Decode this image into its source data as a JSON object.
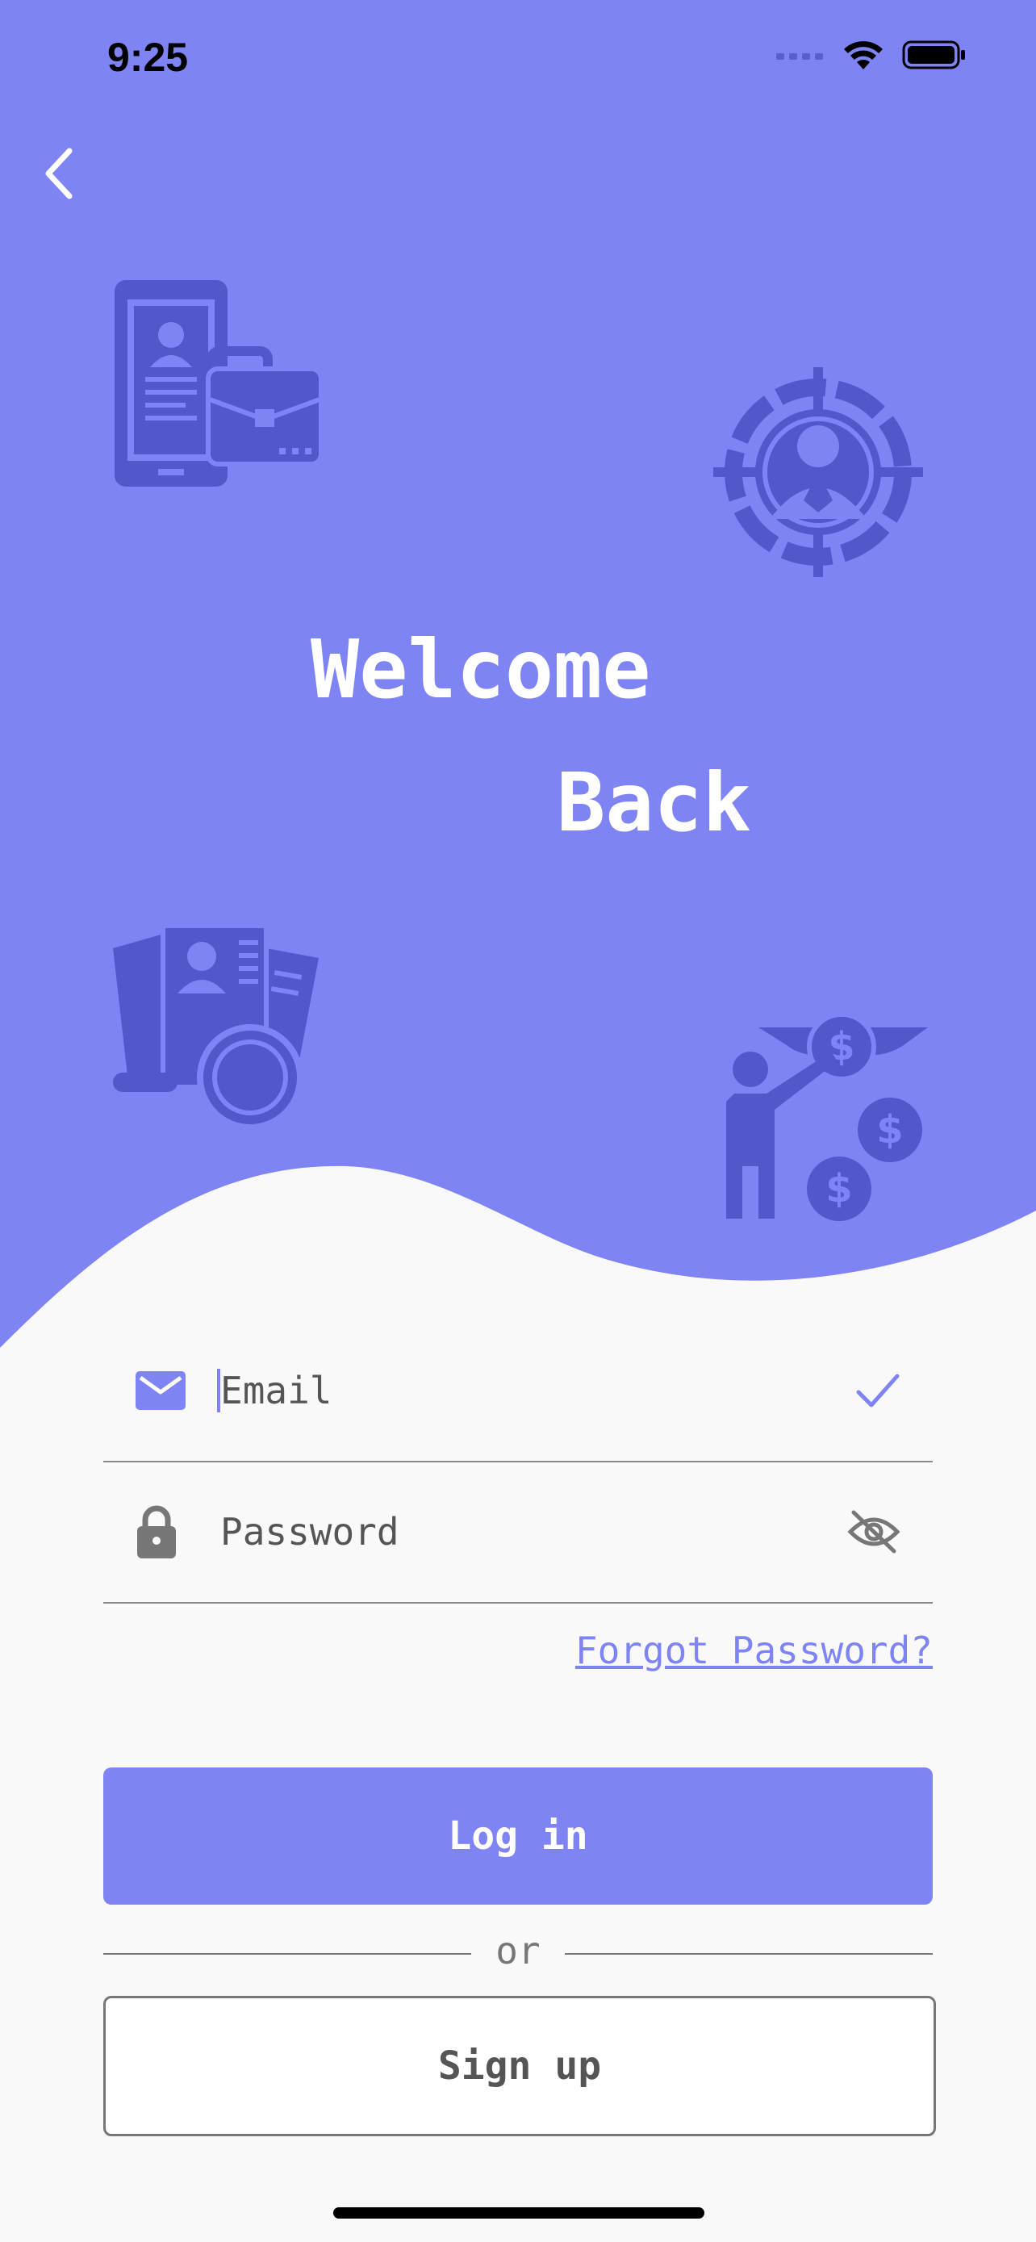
{
  "status_bar": {
    "time": "9:25"
  },
  "header": {
    "title_line1": "Welcome",
    "title_line2": "Back"
  },
  "form": {
    "email": {
      "placeholder": "Email"
    },
    "password": {
      "placeholder": "Password"
    },
    "forgot_label": "Forgot Password?"
  },
  "actions": {
    "login_label": "Log in",
    "or_label": "or",
    "signup_label": "Sign up"
  },
  "colors": {
    "accent": "#7f84f4",
    "accent_dark": "#5158c9",
    "background": "#f9f9f9"
  },
  "icons": [
    "wifi-icon",
    "battery-icon",
    "back-chevron-icon",
    "mail-icon",
    "lock-icon",
    "check-icon",
    "eye-off-icon"
  ]
}
